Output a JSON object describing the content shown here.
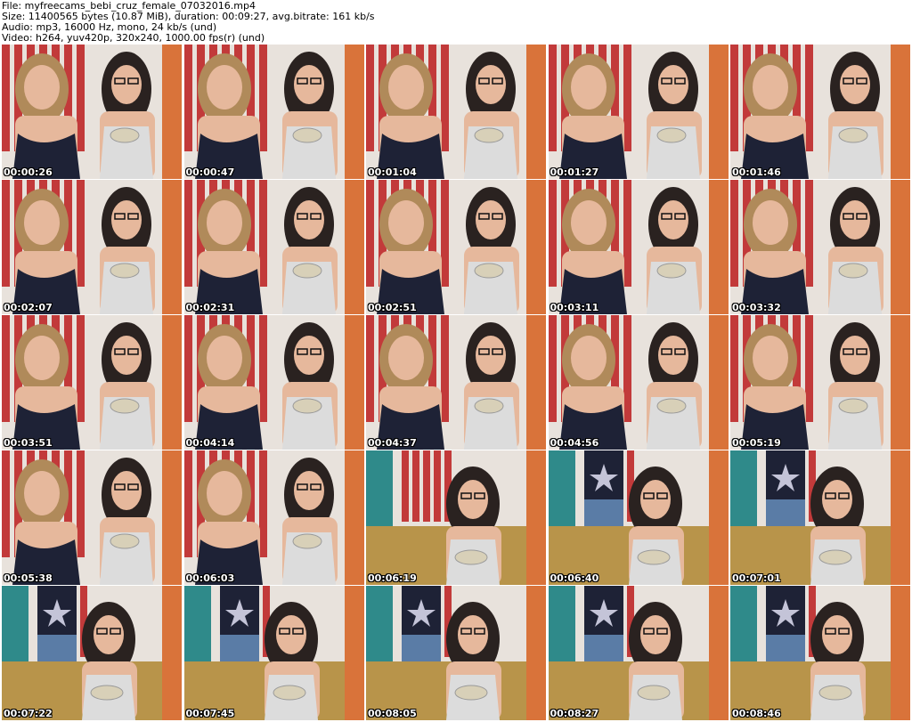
{
  "header": {
    "file_line": "File: myfreecams_bebi_cruz_female_07032016.mp4",
    "size_line": "Size: 11400565 bytes (10.87 MiB), duration: 00:09:27, avg.bitrate: 161 kb/s",
    "audio_line": "Audio: mp3, 16000 Hz, mono, 24 kb/s (und)",
    "video_line": "Video: h264, yuv420p, 320x240, 1000.00 fps(r) (und)"
  },
  "colors": {
    "curtain_red": "#c23a3a",
    "wall_white": "#e8e2dc",
    "wall_orange": "#d9733a",
    "floor_pattern": "#b8944a",
    "teal_bg": "#2f8a8a",
    "skin": "#e6b89c",
    "hair_blonde": "#b08a5a",
    "hair_dark": "#2a2220",
    "top_navy": "#1e2236",
    "top_white": "#dcdcdc",
    "jeans": "#5a7ca6"
  },
  "thumbnails": [
    {
      "time": "00:00:26",
      "scene": "duo"
    },
    {
      "time": "00:00:47",
      "scene": "duo"
    },
    {
      "time": "00:01:04",
      "scene": "duo"
    },
    {
      "time": "00:01:27",
      "scene": "duo"
    },
    {
      "time": "00:01:46",
      "scene": "duo"
    },
    {
      "time": "00:02:07",
      "scene": "duo"
    },
    {
      "time": "00:02:31",
      "scene": "duo"
    },
    {
      "time": "00:02:51",
      "scene": "duo"
    },
    {
      "time": "00:03:11",
      "scene": "duo"
    },
    {
      "time": "00:03:32",
      "scene": "duo"
    },
    {
      "time": "00:03:51",
      "scene": "duo"
    },
    {
      "time": "00:04:14",
      "scene": "duo"
    },
    {
      "time": "00:04:37",
      "scene": "duo"
    },
    {
      "time": "00:04:56",
      "scene": "duo"
    },
    {
      "time": "00:05:19",
      "scene": "duo"
    },
    {
      "time": "00:05:38",
      "scene": "duo"
    },
    {
      "time": "00:06:03",
      "scene": "duo"
    },
    {
      "time": "00:06:19",
      "scene": "solo"
    },
    {
      "time": "00:06:40",
      "scene": "solo-standing"
    },
    {
      "time": "00:07:01",
      "scene": "solo-standing"
    },
    {
      "time": "00:07:22",
      "scene": "solo-standing"
    },
    {
      "time": "00:07:45",
      "scene": "solo-standing"
    },
    {
      "time": "00:08:05",
      "scene": "solo-standing"
    },
    {
      "time": "00:08:27",
      "scene": "solo-standing"
    },
    {
      "time": "00:08:46",
      "scene": "solo-standing"
    }
  ]
}
